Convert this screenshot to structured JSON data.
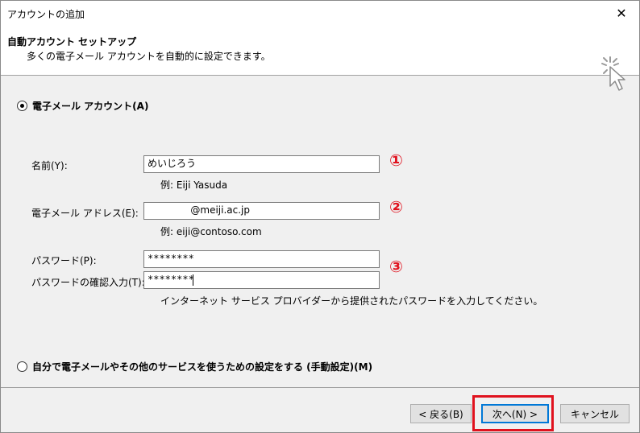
{
  "window": {
    "title": "アカウントの追加",
    "close_symbol": "✕"
  },
  "header": {
    "title": "自動アカウント セットアップ",
    "subtitle": "多くの電子メール アカウントを自動的に設定できます。",
    "icon": "wizard-cursor-icon"
  },
  "options": {
    "email_account": {
      "label": "電子メール アカウント(A)",
      "selected": true
    },
    "manual_setup": {
      "label": "自分で電子メールやその他のサービスを使うための設定をする (手動設定)(M)",
      "selected": false
    }
  },
  "form": {
    "name": {
      "label": "名前(Y):",
      "value": "めいじろう",
      "hint": "例: Eiji Yasuda",
      "marker": "①"
    },
    "email": {
      "label": "電子メール アドレス(E):",
      "value": "              @meiji.ac.jp",
      "hint": "例: eiji@contoso.com",
      "marker": "②"
    },
    "password": {
      "label": "パスワード(P):",
      "value": "********"
    },
    "password_confirm": {
      "label": "パスワードの確認入力(T):",
      "value": "********",
      "marker": "③"
    },
    "password_hint": "インターネット サービス プロバイダーから提供されたパスワードを入力してください。"
  },
  "buttons": {
    "back": "< 戻る(B)",
    "next": "次へ(N) >",
    "cancel": "キャンセル"
  },
  "colors": {
    "annotation_red": "#e0121e",
    "focus_blue": "#0078d7"
  }
}
